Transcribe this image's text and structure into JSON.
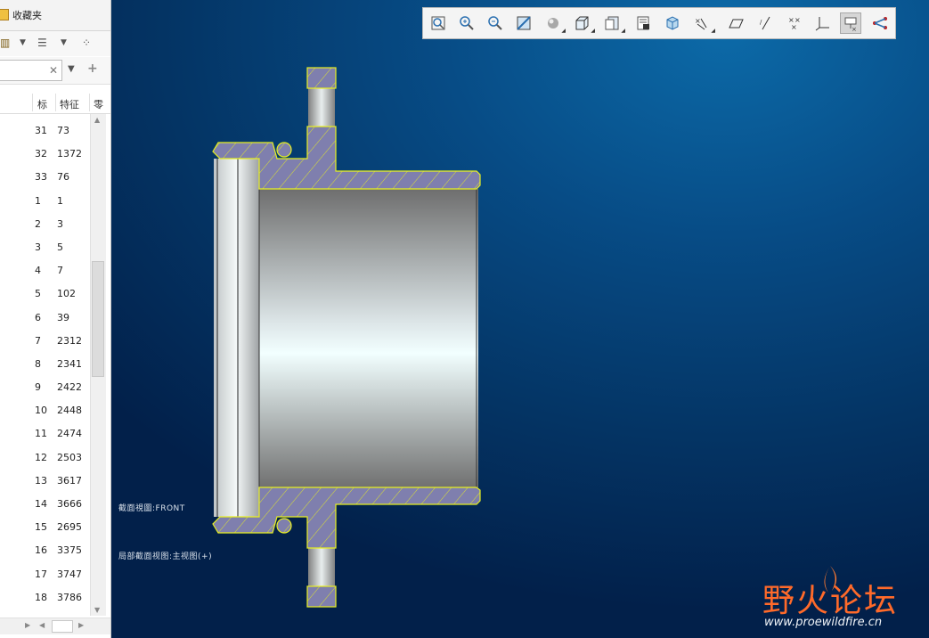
{
  "left_panel": {
    "favorites_tab": "收藏夹",
    "columns": [
      "标",
      "特征",
      "零"
    ],
    "rows": [
      [
        "31",
        "73"
      ],
      [
        "32",
        "1372"
      ],
      [
        "33",
        "76"
      ],
      [
        "1",
        "1"
      ],
      [
        "2",
        "3"
      ],
      [
        "3",
        "5"
      ],
      [
        "4",
        "7"
      ],
      [
        "5",
        "102"
      ],
      [
        "6",
        "39"
      ],
      [
        "7",
        "2312"
      ],
      [
        "8",
        "2341"
      ],
      [
        "9",
        "2422"
      ],
      [
        "10",
        "2448"
      ],
      [
        "11",
        "2474"
      ],
      [
        "12",
        "2503"
      ],
      [
        "13",
        "3617"
      ],
      [
        "14",
        "3666"
      ],
      [
        "15",
        "2695"
      ],
      [
        "16",
        "3375"
      ],
      [
        "17",
        "3747"
      ],
      [
        "18",
        "3786"
      ]
    ]
  },
  "viewport": {
    "toolbar_icons": [
      "refit-icon",
      "zoom-in-icon",
      "zoom-out-icon",
      "repaint-icon",
      "display-style-icon",
      "saved-views-icon",
      "view-manager-icon",
      "perspective-icon",
      "spin-center-icon",
      "annotation-display-icon",
      "datum-plane-icon",
      "datum-axis-icon",
      "datum-point-icon",
      "csys-display-icon",
      "annotation-filter-icon",
      "sketch-display-icon"
    ],
    "active_tool": "annotation-filter-icon",
    "annotation_1": "截面視圖:FRONT",
    "annotation_2": "局部截面视图:主视图(+)",
    "colors": {
      "section_fill": "#7f7fae",
      "section_edge": "#e8f020",
      "background": "#043464"
    }
  },
  "watermark": {
    "title": "野火论坛",
    "url": "www.proewildfire.cn"
  }
}
